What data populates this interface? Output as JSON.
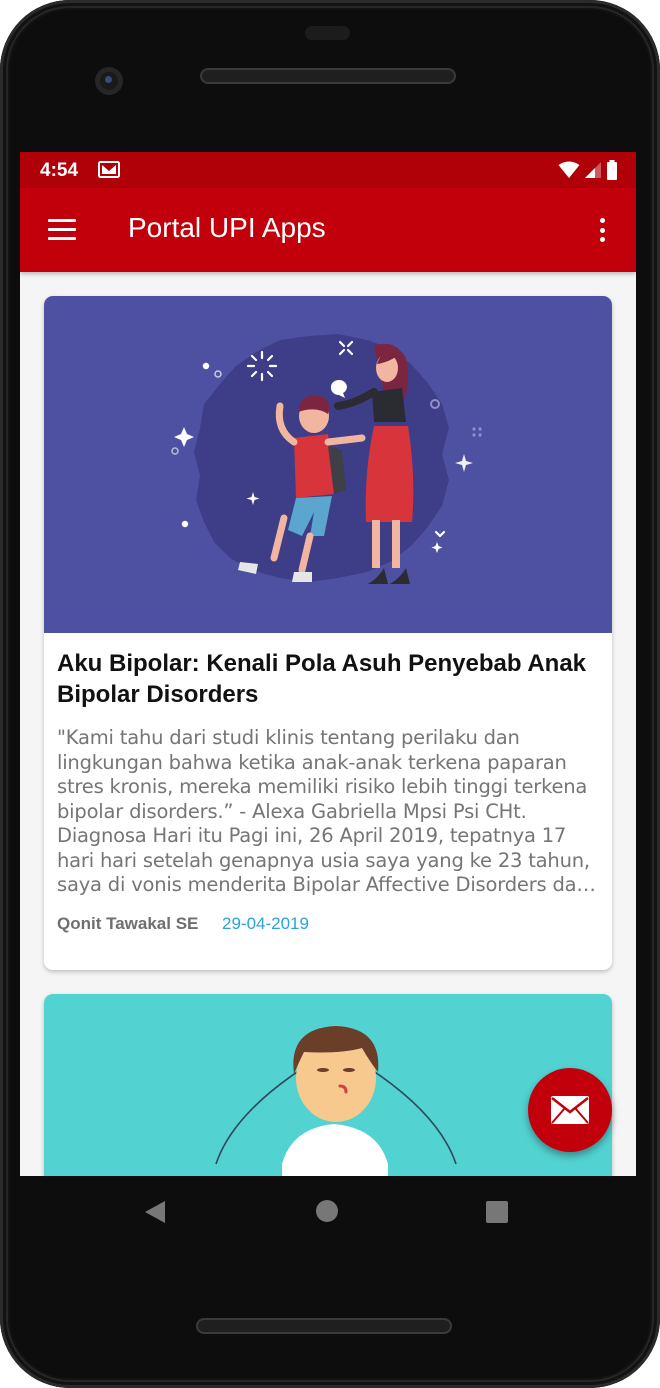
{
  "status_bar": {
    "time": "4:54",
    "icons": [
      "mail-notification-icon",
      "wifi-icon",
      "signal-icon",
      "battery-icon"
    ]
  },
  "app_bar": {
    "title": "Portal UPI Apps",
    "left_icon": "menu-icon",
    "right_icon": "overflow-menu-icon",
    "color": "#c1000b"
  },
  "articles": [
    {
      "title": "Aku Bipolar: Kenali Pola Asuh Penyebab Anak Bipolar Disorders",
      "excerpt": "\"Kami tahu dari studi klinis tentang perilaku dan lingkungan bahwa ketika anak-anak terkena paparan stres kronis, mereka memiliki risiko lebih tinggi terkena bipolar disorders.” - Alexa Gabriella Mpsi Psi CHt. Diagnosa Hari itu Pagi ini, 26 April 2019, tepatnya 17 hari hari setelah genapnya usia saya yang ke 23 tahun, saya di vonis menderita Bipolar Affective Disorders dan dirujuk ke Poli…",
      "author": "Qonit Tawakal SE",
      "date": "29-04-2019",
      "image_bg": "#4e51a1"
    },
    {
      "image_bg": "#52d3d2"
    }
  ],
  "fab": {
    "icon": "mail-icon",
    "color": "#c1000b"
  },
  "nav_bar": {
    "buttons": [
      "back-icon",
      "home-icon",
      "recents-icon"
    ]
  }
}
